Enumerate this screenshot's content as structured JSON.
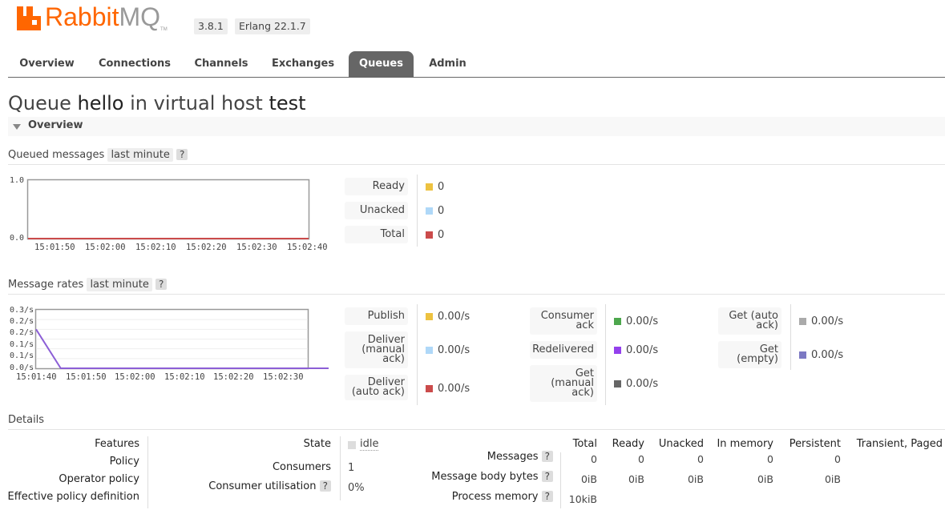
{
  "header": {
    "brand_main": "Rabbit",
    "brand_mq": "MQ",
    "brand_tm": "TM",
    "version": "3.8.1",
    "erlang": "Erlang 22.1.7"
  },
  "nav": {
    "tabs": [
      {
        "label": "Overview"
      },
      {
        "label": "Connections"
      },
      {
        "label": "Channels"
      },
      {
        "label": "Exchanges"
      },
      {
        "label": "Queues",
        "active": true
      },
      {
        "label": "Admin"
      }
    ]
  },
  "title": {
    "prefix": "Queue",
    "queue": "hello",
    "middle": "in virtual host",
    "vhost": "test"
  },
  "overview_label": "Overview",
  "queued": {
    "label": "Queued messages",
    "range": "last minute",
    "help": "?",
    "legend": [
      {
        "label": "Ready",
        "value": "0",
        "color": "#edc240"
      },
      {
        "label": "Unacked",
        "value": "0",
        "color": "#afd8f8"
      },
      {
        "label": "Total",
        "value": "0",
        "color": "#cb4b4b"
      }
    ]
  },
  "rates": {
    "label": "Message rates",
    "range": "last minute",
    "help": "?",
    "legend_col1": [
      {
        "label": "Publish",
        "value": "0.00/s",
        "color": "#edc240"
      },
      {
        "label": "Deliver (manual ack)",
        "value": "0.00/s",
        "color": "#afd8f8"
      },
      {
        "label": "Deliver (auto ack)",
        "value": "0.00/s",
        "color": "#cb4b4b"
      }
    ],
    "legend_col2": [
      {
        "label": "Consumer ack",
        "value": "0.00/s",
        "color": "#4da74d"
      },
      {
        "label": "Redelivered",
        "value": "0.00/s",
        "color": "#9440ed"
      },
      {
        "label": "Get (manual ack)",
        "value": "0.00/s",
        "color": "#666666"
      }
    ],
    "legend_col3": [
      {
        "label": "Get (auto ack)",
        "value": "0.00/s",
        "color": "#aaaaaa"
      },
      {
        "label": "Get (empty)",
        "value": "0.00/s",
        "color": "#7c79c3"
      }
    ]
  },
  "chart_data": [
    {
      "type": "line",
      "title": "Queued messages",
      "ylim": [
        0,
        1.0
      ],
      "y_ticks": [
        "1.0",
        "0.0"
      ],
      "x_ticks": [
        "15:01:50",
        "15:02:00",
        "15:02:10",
        "15:02:20",
        "15:02:30",
        "15:02:40"
      ],
      "series": [
        {
          "name": "Total",
          "x": [
            "15:01:45",
            "15:02:45"
          ],
          "values": [
            0,
            0
          ]
        }
      ]
    },
    {
      "type": "line",
      "title": "Message rates",
      "ylim": [
        0,
        0.3
      ],
      "y_ticks": [
        "0.3/s",
        "0.2/s",
        "0.2/s",
        "0.1/s",
        "0.1/s",
        "0.0/s"
      ],
      "x_ticks": [
        "15:01:40",
        "15:01:50",
        "15:02:00",
        "15:02:10",
        "15:02:20",
        "15:02:30"
      ],
      "series": [
        {
          "x": [
            "15:01:40",
            "15:01:45",
            "15:02:40"
          ],
          "values": [
            0.2,
            0,
            0
          ]
        }
      ]
    }
  ],
  "details": {
    "label": "Details",
    "left_labels": [
      "Features",
      "Policy",
      "Operator policy",
      "Effective policy definition"
    ],
    "state_label": "State",
    "state_value": "idle",
    "consumers_label": "Consumers",
    "consumers_value": "1",
    "util_label": "Consumer utilisation",
    "util_help": "?",
    "util_value": "0%",
    "table": {
      "headers": [
        "Total",
        "Ready",
        "Unacked",
        "In memory",
        "Persistent",
        "Transient, Paged"
      ],
      "rows": [
        {
          "label": "Messages",
          "help": "?",
          "cells": [
            "0",
            "0",
            "0",
            "0",
            "0"
          ]
        },
        {
          "label": "Message body bytes",
          "help": "?",
          "cells": [
            "0iB",
            "0iB",
            "0iB",
            "0iB",
            "0iB"
          ]
        },
        {
          "label": "Process memory",
          "help": "?",
          "cells": [
            "10kiB"
          ]
        }
      ]
    }
  }
}
